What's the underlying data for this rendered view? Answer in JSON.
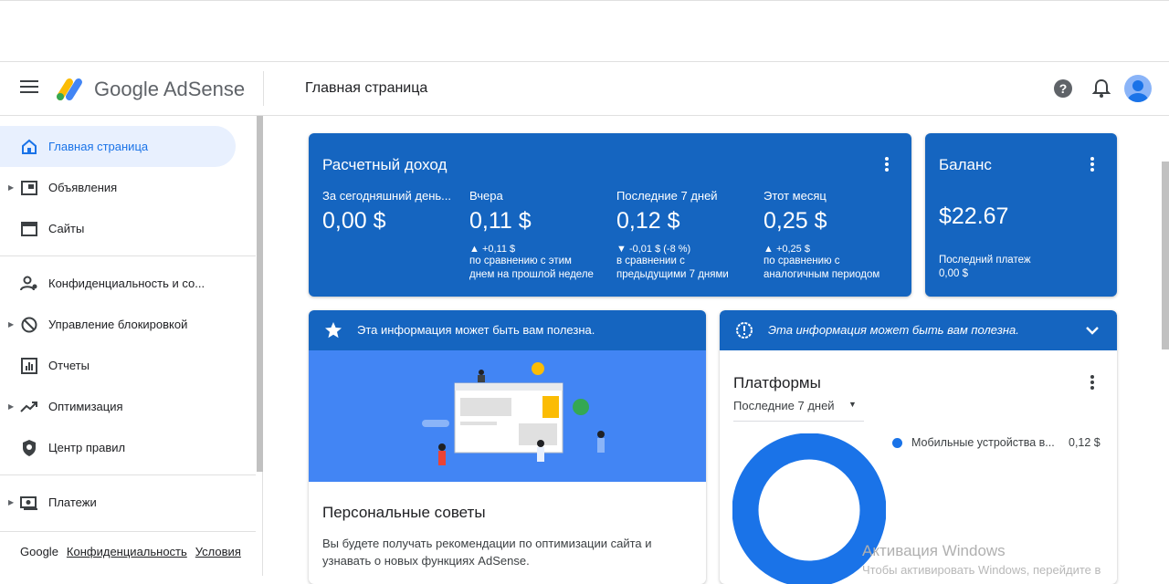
{
  "header": {
    "brand": "Google AdSense",
    "page_title": "Главная страница"
  },
  "sidebar": {
    "items": [
      {
        "label": "Главная страница"
      },
      {
        "label": "Объявления"
      },
      {
        "label": "Сайты"
      },
      {
        "label": "Конфиденциальность и со..."
      },
      {
        "label": "Управление блокировкой"
      },
      {
        "label": "Отчеты"
      },
      {
        "label": "Оптимизация"
      },
      {
        "label": "Центр правил"
      },
      {
        "label": "Платежи"
      }
    ],
    "footer": {
      "google": "Google",
      "privacy": "Конфиденциальность",
      "terms": "Условия"
    }
  },
  "revenue": {
    "title": "Расчетный доход",
    "metrics": [
      {
        "label": "За сегодняшний день...",
        "value": "0,00 $",
        "delta": "",
        "note1": "",
        "note2": ""
      },
      {
        "label": "Вчера",
        "value": "0,11 $",
        "delta": "▲ +0,11 $",
        "note1": "по сравнению с этим",
        "note2": "днем на прошлой неделе"
      },
      {
        "label": "Последние 7 дней",
        "value": "0,12 $",
        "delta": "▼ -0,01 $ (-8 %)",
        "note1": "в сравнении с",
        "note2": "предыдущими 7 днями"
      },
      {
        "label": "Этот месяц",
        "value": "0,25 $",
        "delta": "▲ +0,25 $",
        "note1": "по сравнению с",
        "note2": "аналогичным периодом"
      }
    ]
  },
  "balance": {
    "title": "Баланс",
    "value": "$22.67",
    "last_payment_label": "Последний платеж",
    "last_payment_value": "0,00 $"
  },
  "tips_card": {
    "banner": "Эта информация может быть вам полезна.",
    "title": "Персональные советы",
    "text1": "Вы будете получать рекомендации по оптимизации сайта и",
    "text2": "узнавать о новых функциях AdSense."
  },
  "platforms_card": {
    "banner": "Эта информация может быть вам полезна.",
    "title": "Платформы",
    "period": "Последние 7 дней",
    "legend_label": "Мобильные устройства в...",
    "legend_value": "0,12 $"
  },
  "watermark": {
    "line1": "Активация Windows",
    "line2": "Чтобы активировать Windows, перейдите в"
  },
  "colors": {
    "accent": "#1565c0",
    "active_nav_bg": "#e8f0fe",
    "active_nav_text": "#1a73e8",
    "donut": "#1a73e8"
  }
}
